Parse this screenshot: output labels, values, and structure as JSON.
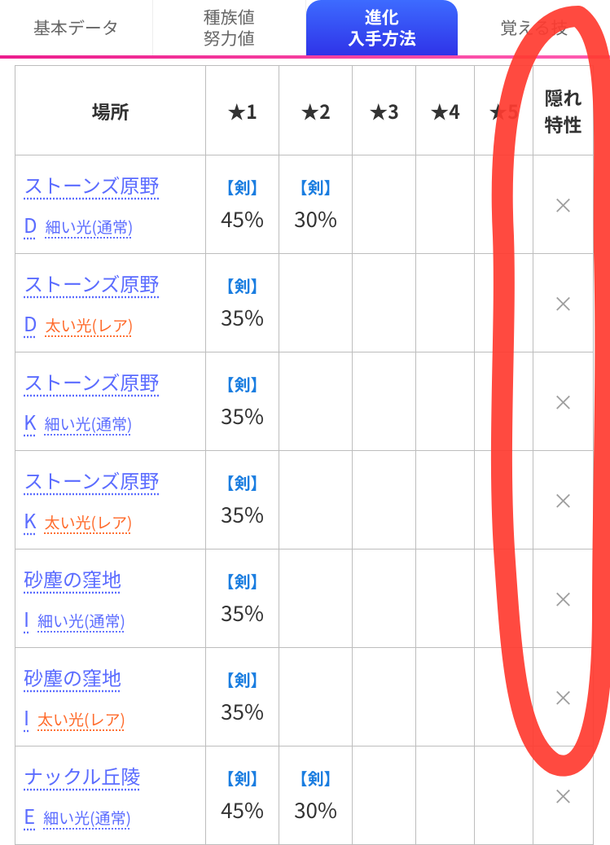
{
  "tabs": [
    {
      "label": "基本データ",
      "active": false
    },
    {
      "label": "種族値\n努力値",
      "active": false
    },
    {
      "label": "進化\n入手方法",
      "active": true
    },
    {
      "label": "覚える技",
      "active": false
    }
  ],
  "columns": {
    "place": "場所",
    "star1": "★1",
    "star2": "★2",
    "star3": "★3",
    "star4": "★4",
    "star5": "★5",
    "hidden_ability": "隠れ\n特性"
  },
  "game_tag": "【剣】",
  "x_mark": "×",
  "rows": [
    {
      "loc": "ストーンズ原野",
      "letter": "D",
      "sub": "細い光(通常)",
      "sub_kind": "normal",
      "star1": "45%",
      "star2": "30%",
      "hidden": "×"
    },
    {
      "loc": "ストーンズ原野",
      "letter": "D",
      "sub": "太い光(レア)",
      "sub_kind": "rare",
      "star1": "35%",
      "star2": "",
      "hidden": "×"
    },
    {
      "loc": "ストーンズ原野",
      "letter": "K",
      "sub": "細い光(通常)",
      "sub_kind": "normal",
      "star1": "35%",
      "star2": "",
      "hidden": "×"
    },
    {
      "loc": "ストーンズ原野",
      "letter": "K",
      "sub": "太い光(レア)",
      "sub_kind": "rare",
      "star1": "35%",
      "star2": "",
      "hidden": "×"
    },
    {
      "loc": "砂塵の窪地",
      "letter": "I",
      "sub": "細い光(通常)",
      "sub_kind": "normal",
      "star1": "35%",
      "star2": "",
      "hidden": "×"
    },
    {
      "loc": "砂塵の窪地",
      "letter": "I",
      "sub": "太い光(レア)",
      "sub_kind": "rare",
      "star1": "35%",
      "star2": "",
      "hidden": "×"
    },
    {
      "loc": "ナックル丘陵",
      "letter": "E",
      "sub": "細い光(通常)",
      "sub_kind": "normal",
      "star1": "45%",
      "star2": "30%",
      "hidden": "×"
    }
  ]
}
